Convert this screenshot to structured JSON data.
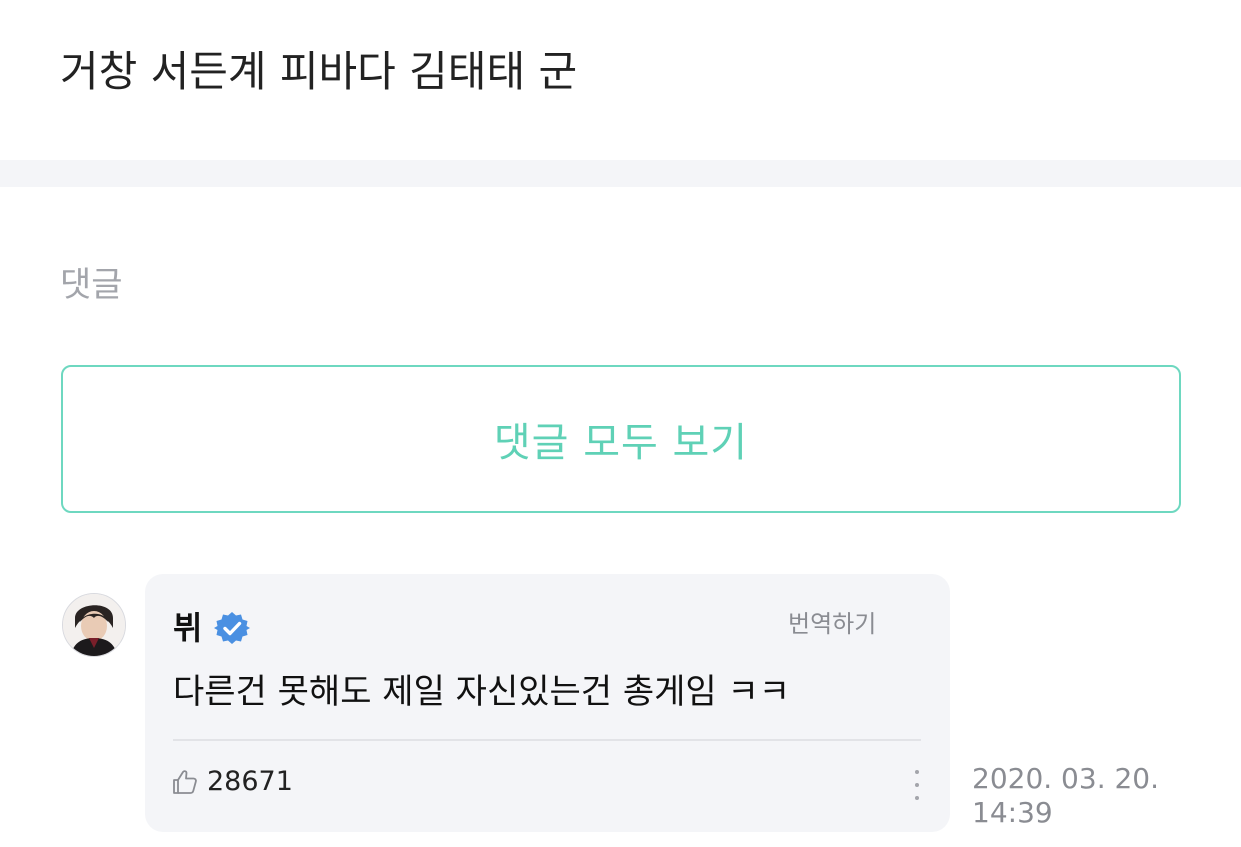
{
  "post": {
    "title": "거창 서든계 피바다 김태태 군"
  },
  "comments_section": {
    "label": "댓글",
    "view_all_label": "댓글 모두 보기"
  },
  "comment": {
    "author": "뷔",
    "verified_icon": "verified-badge-icon",
    "translate_label": "번역하기",
    "text": "다른건 못해도 제일 자신있는건 총게임 ㅋㅋ",
    "likes": "28671",
    "like_icon": "thumbs-up-icon",
    "more_icon": "more-vertical-icon",
    "date": "2020. 03. 20.",
    "time": "14:39"
  },
  "colors": {
    "accent": "#5fd1b6",
    "accent_border": "#6ed8c0",
    "verified": "#4a90e2",
    "bubble_bg": "#f4f5f8"
  }
}
